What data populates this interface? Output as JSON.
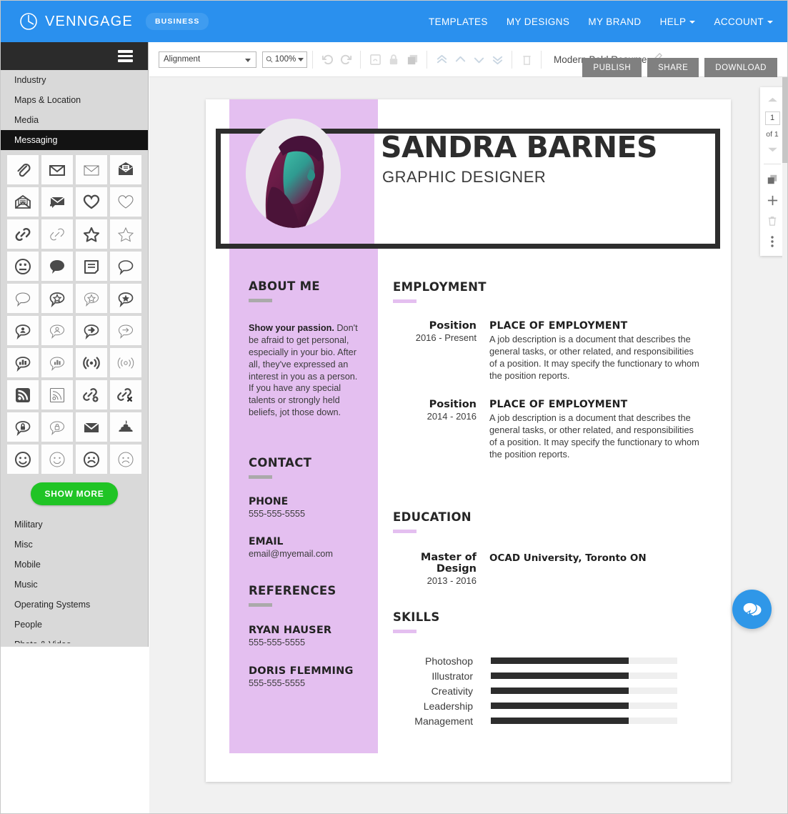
{
  "topnav": {
    "brand_name": "VENNGAGE",
    "badge": "BUSINESS",
    "links": [
      {
        "label": "TEMPLATES",
        "caret": false
      },
      {
        "label": "MY DESIGNS",
        "caret": false
      },
      {
        "label": "MY BRAND",
        "caret": false
      },
      {
        "label": "HELP",
        "caret": true
      },
      {
        "label": "ACCOUNT",
        "caret": true
      }
    ],
    "bg_color": "#2a90ee"
  },
  "toolbar": {
    "alignment_select": "Alignment",
    "zoom_value": "100%",
    "doc_title": "Modern Bold Resume",
    "publish_label": "PUBLISH",
    "share_label": "SHARE",
    "download_label": "DOWNLOAD"
  },
  "sidebar": {
    "categories_top": [
      {
        "label": "Industry",
        "active": false
      },
      {
        "label": "Maps & Location",
        "active": false
      },
      {
        "label": "Media",
        "active": false
      },
      {
        "label": "Messaging",
        "active": true
      }
    ],
    "show_more_label": "SHOW MORE",
    "categories_bottom": [
      {
        "label": "Military"
      },
      {
        "label": "Misc"
      },
      {
        "label": "Mobile"
      },
      {
        "label": "Music"
      },
      {
        "label": "Operating Systems"
      },
      {
        "label": "People"
      },
      {
        "label": "Photo & Video"
      }
    ],
    "icons": [
      "paperclip-icon",
      "envelope-outline-icon",
      "envelope-thin-icon",
      "envelope-chat-filled-icon",
      "envelope-open-icon",
      "envelope-reply-filled-icon",
      "heart-bold-icon",
      "heart-thin-icon",
      "link-bold-icon",
      "link-thin-icon",
      "star-bold-icon",
      "star-thin-icon",
      "face-silent-icon",
      "speech-bubble-filled-icon",
      "note-lines-icon",
      "speech-bubble-thin-icon",
      "speech-bubble-outline-icon",
      "speech-bubble-star-icon",
      "speech-bubble-star-thin-icon",
      "speech-bubble-star-filled-icon",
      "speech-bubble-user-icon",
      "speech-bubble-user-thin-icon",
      "speech-bubble-arrow-icon",
      "speech-bubble-arrow-thin-icon",
      "speech-bubble-chart-icon",
      "speech-bubble-chart-thin-icon",
      "signal-waves-icon",
      "signal-waves-thin-icon",
      "rss-filled-icon",
      "rss-outline-icon",
      "link-add-icon",
      "link-remove-icon",
      "speech-bubble-lock-icon",
      "speech-bubble-lock-thin-icon",
      "envelope-filled-icon",
      "poop-icon",
      "face-smile-bold-icon",
      "face-smile-thin-icon",
      "face-sad-bold-icon",
      "face-sad-thin-icon"
    ]
  },
  "page_panel": {
    "current_page": "1",
    "of_label": "of 1"
  },
  "resume": {
    "name": "SANDRA BARNES",
    "role": "GRAPHIC DESIGNER",
    "accent_color": "#e4bff0",
    "about": {
      "heading": "ABOUT ME",
      "lead": "Show your passion.",
      "body": " Don't be afraid to get personal, especially in your bio. After all, they've expressed an interest in you as a person. If you have any special talents or strongly held beliefs, jot those down."
    },
    "contact": {
      "heading": "CONTACT",
      "phone_label": "PHONE",
      "phone_value": "555-555-5555",
      "email_label": "EMAIL",
      "email_value": "email@myemail.com"
    },
    "references": {
      "heading": "REFERENCES",
      "items": [
        {
          "name": "RYAN HAUSER",
          "phone": "555-555-5555"
        },
        {
          "name": "DORIS FLEMMING",
          "phone": "555-555-5555"
        }
      ]
    },
    "employment": {
      "heading": "EMPLOYMENT",
      "jobs": [
        {
          "position": "Position",
          "years": "2016 - Present",
          "place": "PLACE OF EMPLOYMENT",
          "description": "A job description is a document that describes the general tasks, or other related, and responsibilities of a position. It may specify the functionary to whom the position reports."
        },
        {
          "position": "Position",
          "years": "2014 - 2016",
          "place": "PLACE OF EMPLOYMENT",
          "description": "A job description is a document that describes the general tasks, or other related, and responsibilities of a position. It may specify the functionary to whom the position reports."
        }
      ]
    },
    "education": {
      "heading": "EDUCATION",
      "degree": "Master of Design",
      "years": "2013 - 2016",
      "school": "OCAD University, Toronto ON"
    },
    "skills": {
      "heading": "SKILLS",
      "items": [
        {
          "label": "Photoshop",
          "value": 74
        },
        {
          "label": "Illustrator",
          "value": 74
        },
        {
          "label": "Creativity",
          "value": 74
        },
        {
          "label": "Leadership",
          "value": 74
        },
        {
          "label": "Management",
          "value": 74
        }
      ]
    }
  }
}
